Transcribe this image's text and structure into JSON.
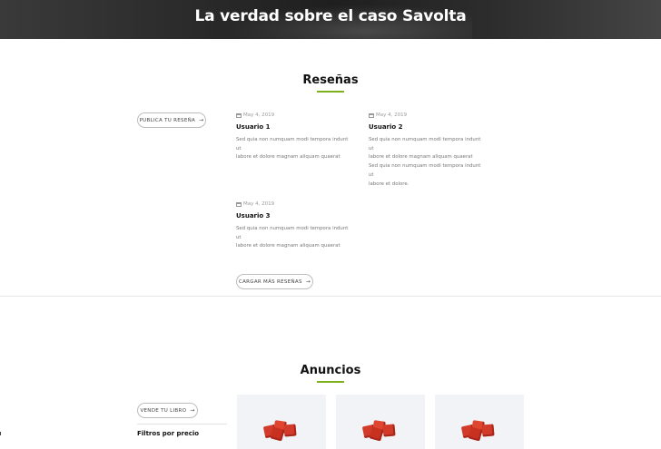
{
  "hero": {
    "title": "La verdad sobre el caso Savolta"
  },
  "reviews_section": {
    "title": "Reseñas",
    "publish_button": "PUBLICA TU RESEÑA",
    "load_more_button": "CARGAR MÁS RESEÑAS",
    "arrow": "→",
    "items": [
      {
        "date": "May 4, 2019",
        "name": "Usuario 1",
        "lines": [
          "Sed quia non numquam modi tempora indunt ut",
          "labore et dolore magnam aliquam quaerat"
        ]
      },
      {
        "date": "May 4, 2019",
        "name": "Usuario 2",
        "lines": [
          "Sed quia non numquam modi tempora indunt ut",
          "labore et dolore magnam aliquam quaerat",
          "Sed quia non numquam modi tempora indunt ut",
          "labore et dolore."
        ]
      },
      {
        "date": "May 4, 2019",
        "name": "Usuario 3",
        "lines": [
          "Sed quia non numquam modi tempora indunt ut",
          "labore et dolore magnam aliquam quaerat"
        ]
      }
    ]
  },
  "ads_section": {
    "title": "Anuncios",
    "sell_button": "VENDE TU LIBRO",
    "filters_label": "Filtros por precio",
    "cards": [
      {
        "image": "product-icon"
      },
      {
        "image": "product-icon"
      },
      {
        "image": "product-icon"
      }
    ]
  },
  "colors": {
    "accent": "#7fb11d",
    "hero_bg": "#2a2a2a"
  }
}
